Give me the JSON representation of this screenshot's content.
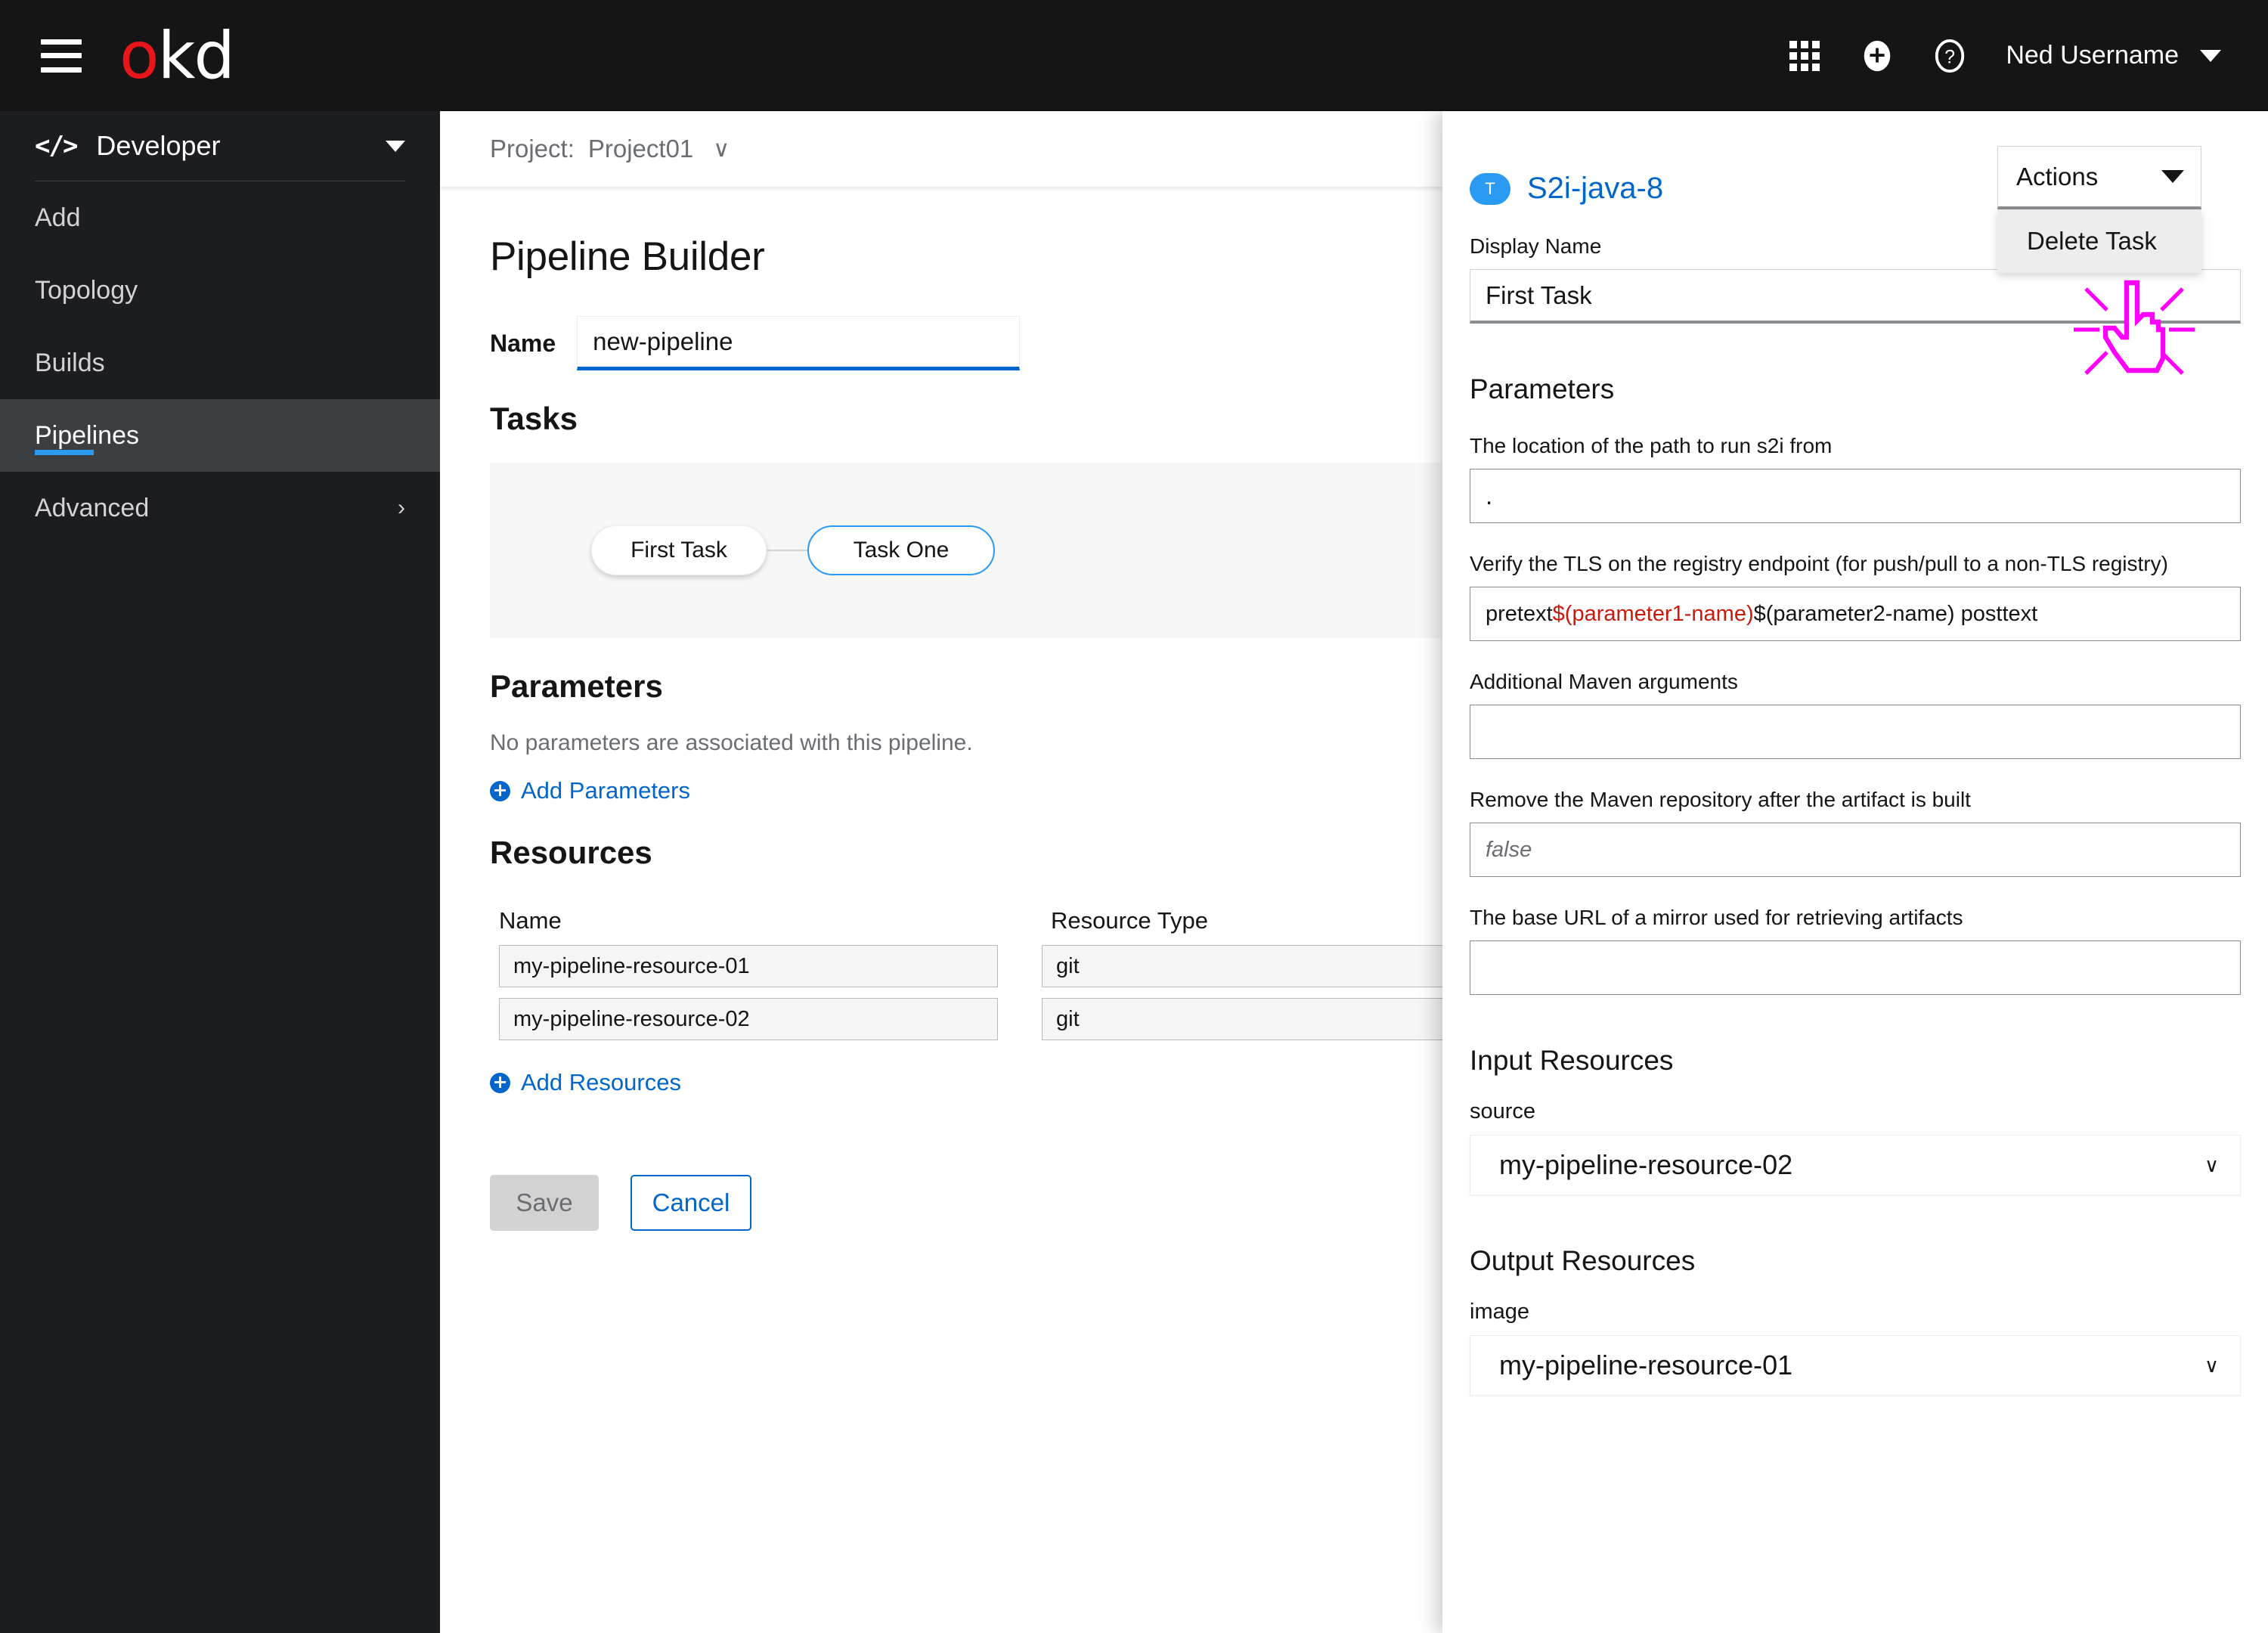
{
  "masthead": {
    "logo_o": "o",
    "logo_kd": "kd",
    "hamburger_icon": "hamburger-icon",
    "apps_icon": "grid-apps-icon",
    "add_icon": "plus-circle-icon",
    "help_icon": "question-circle-icon",
    "username": "Ned Username",
    "user_caret_icon": "caret-down-icon"
  },
  "sidebar": {
    "persona": "Developer",
    "persona_icon": "code-brackets-icon",
    "persona_caret_icon": "caret-down-icon",
    "items": [
      {
        "label": "Add",
        "active": false
      },
      {
        "label": "Topology",
        "active": false
      },
      {
        "label": "Builds",
        "active": false
      },
      {
        "label": "Pipelines",
        "active": true
      },
      {
        "label": "Advanced",
        "active": false,
        "chevron": "›"
      }
    ]
  },
  "projectbar": {
    "label": "Project:",
    "value": "Project01",
    "caret": "∨"
  },
  "main": {
    "page_title": "Pipeline Builder",
    "name_label": "Name",
    "name_value": "new-pipeline",
    "tasks_heading": "Tasks",
    "tasks": [
      {
        "label": "First Task",
        "selected": false
      },
      {
        "label": "Task One",
        "selected": true
      }
    ],
    "parameters_heading": "Parameters",
    "parameters_empty": "No parameters are associated with this pipeline.",
    "add_parameters_label": "Add Parameters",
    "resources_heading": "Resources",
    "resources_columns": [
      "Name",
      "Resource Type"
    ],
    "resources_rows": [
      {
        "name": "my-pipeline-resource-01",
        "type": "git"
      },
      {
        "name": "my-pipeline-resource-02",
        "type": "git"
      }
    ],
    "add_resources_label": "Add Resources",
    "save_label": "Save",
    "cancel_label": "Cancel"
  },
  "sidepanel": {
    "badge": "T",
    "title": "S2i-java-8",
    "actions_label": "Actions",
    "actions_caret_icon": "caret-down-icon",
    "actions_menu": [
      "Delete Task"
    ],
    "display_name_label": "Display Name",
    "display_name_value": "First Task",
    "parameters_heading": "Parameters",
    "parameters": [
      {
        "label": "The location of the path to run s2i from",
        "value": ".",
        "placeholder": false
      },
      {
        "label": "Verify the TLS on the registry endpoint (for push/pull to a non-TLS registry)",
        "value_pre": "pretext ",
        "value_red": "$(parameter1-name)",
        "value_post": " $(parameter2-name) posttext",
        "placeholder": false
      },
      {
        "label": "Additional Maven arguments",
        "value": "",
        "placeholder": false
      },
      {
        "label": "Remove the Maven repository after the artifact is built",
        "value": "false",
        "placeholder": true
      },
      {
        "label": "The base URL of a mirror used for retrieving artifacts",
        "value": "",
        "placeholder": false
      }
    ],
    "input_resources_heading": "Input Resources",
    "input_resources": [
      {
        "label": "source",
        "value": "my-pipeline-resource-02"
      }
    ],
    "output_resources_heading": "Output Resources",
    "output_resources": [
      {
        "label": "image",
        "value": "my-pipeline-resource-01"
      }
    ],
    "cursor_icon": "click-hand-cursor"
  },
  "colors": {
    "masthead_bg": "#151515",
    "sidebar_bg": "#1b1d21",
    "sidebar_active_bg": "#3c3f42",
    "accent_blue": "#0066cc",
    "light_blue": "#2b9af3",
    "logo_red": "#e8161b",
    "error_red": "#c9190b",
    "cursor_magenta": "#ff00d0"
  }
}
